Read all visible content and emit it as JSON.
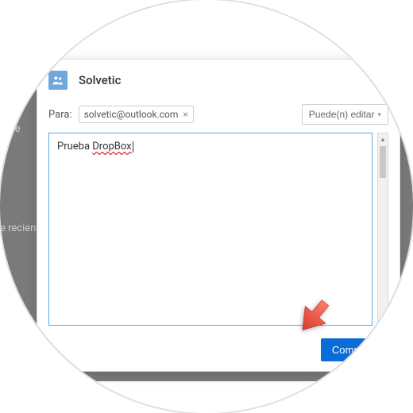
{
  "background": {
    "left_text_1": "mue",
    "left_text_2": "e recient"
  },
  "modal": {
    "title": "Solvetic",
    "icon": "contact-icon",
    "close_label": "×",
    "to_label": "Para:",
    "recipient": {
      "email": "solvetic@outlook.com",
      "remove": "×"
    },
    "permission": {
      "label": "Puede(n) editar",
      "chevron": "▾"
    },
    "message": {
      "plain": "Prueba ",
      "misspelled": "DropBox"
    },
    "scrollbar": {
      "up": "▲",
      "down": "▼"
    },
    "share_button": "Compartir"
  }
}
